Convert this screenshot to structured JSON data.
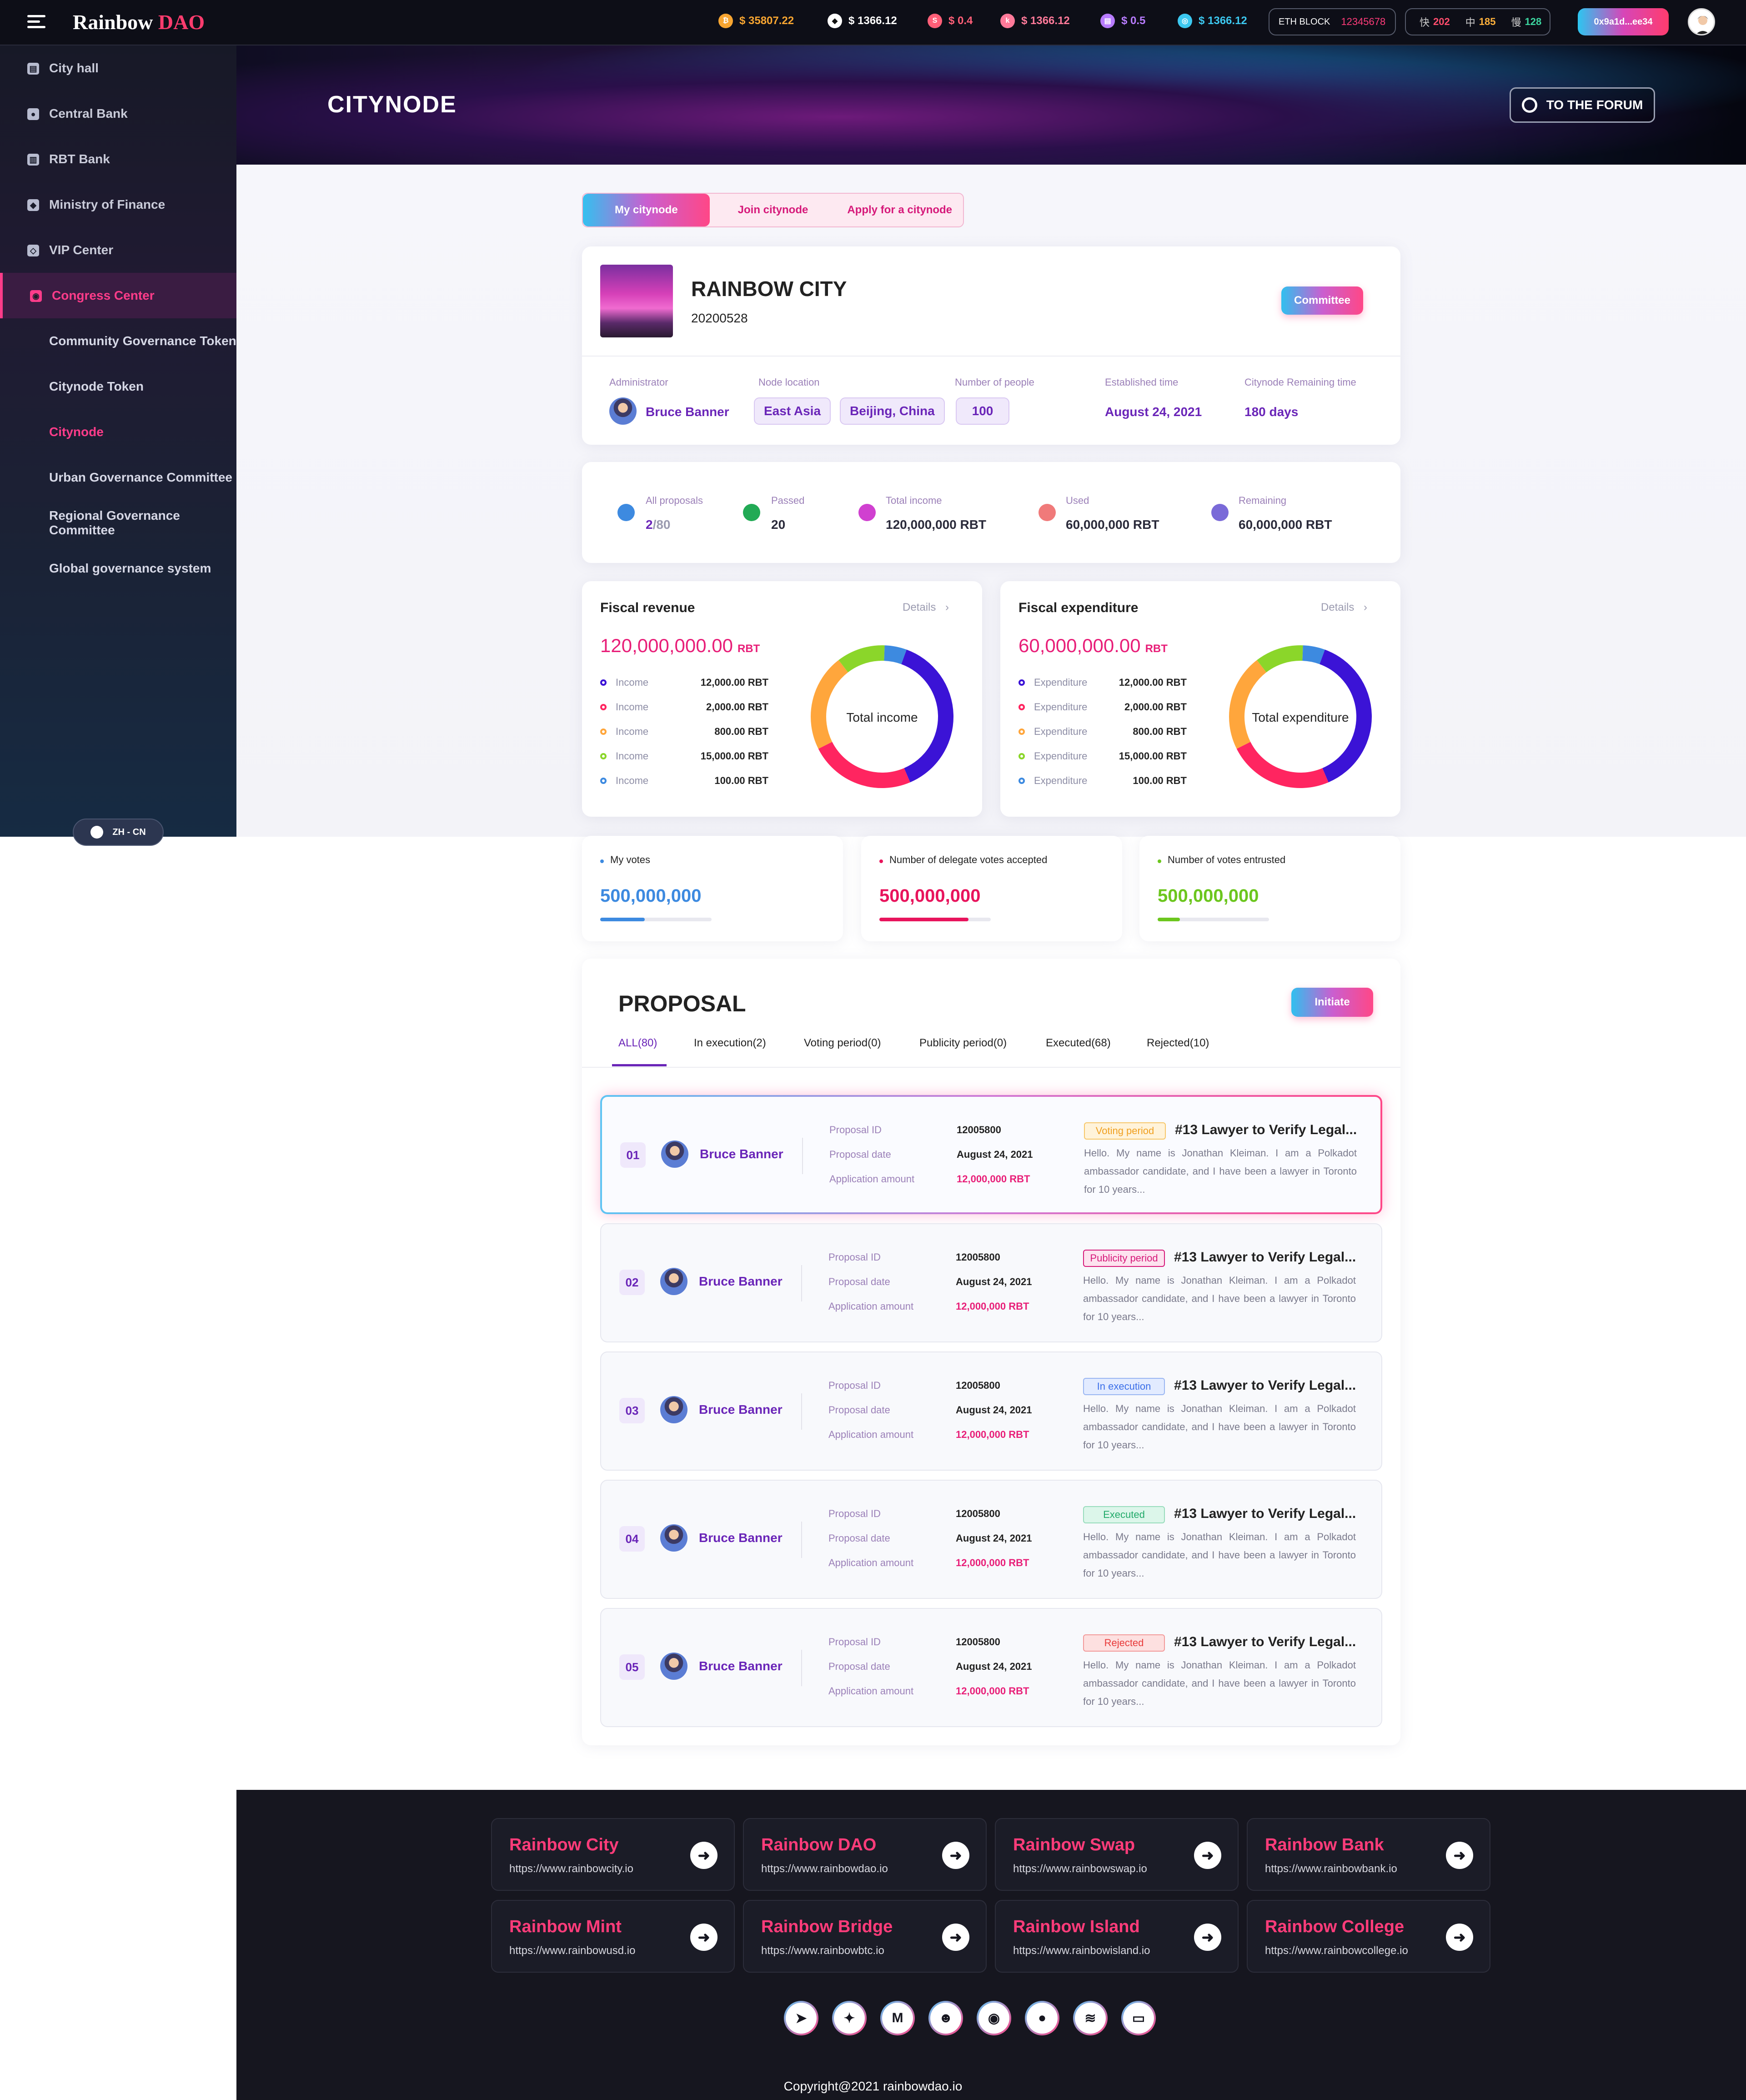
{
  "topbar": {
    "logo_main": "Rainbow",
    "logo_accent": "DAO",
    "prices": [
      {
        "icon": "bitcoin-icon",
        "symbol": "₿",
        "value": "$ 35807.22",
        "color": "#f7a531"
      },
      {
        "icon": "eth-icon",
        "symbol": "◆",
        "value": "$ 1366.12",
        "color": "#ffffff"
      },
      {
        "icon": "token-s-icon",
        "symbol": "S",
        "value": "$ 0.4",
        "color": "#ff5f78"
      },
      {
        "icon": "token-k-icon",
        "symbol": "k",
        "value": "$ 1366.12",
        "color": "#ff7a9a"
      },
      {
        "icon": "token-c-icon",
        "symbol": "▤",
        "value": "$ 0.5",
        "color": "#b87cff"
      },
      {
        "icon": "token-d-icon",
        "symbol": "◎",
        "value": "$ 1366.12",
        "color": "#3cc8f0"
      }
    ],
    "eth_block_label": "ETH BLOCK",
    "eth_block_value": "12345678",
    "speeds": [
      {
        "label": "快",
        "value": "202",
        "color": "#ff4d6d"
      },
      {
        "label": "中",
        "value": "185",
        "color": "#ffb13c"
      },
      {
        "label": "慢",
        "value": "128",
        "color": "#3cd6a0"
      }
    ],
    "wallet": "0x9a1d...ee34"
  },
  "sidebar": {
    "items": [
      {
        "label": "City hall",
        "icon": "chart-icon"
      },
      {
        "label": "Central Bank",
        "icon": "coin-icon"
      },
      {
        "label": "RBT Bank",
        "icon": "bank-icon"
      },
      {
        "label": "Ministry of Finance",
        "icon": "cube-icon"
      },
      {
        "label": "VIP Center",
        "icon": "diamond-icon"
      },
      {
        "label": "Congress Center",
        "icon": "chat-icon"
      }
    ],
    "subitems": [
      "Community Governance Token",
      "Citynode Token",
      "Citynode",
      "Urban Governance Committee",
      "Regional Governance Committee",
      "Global governance system"
    ],
    "lang": "ZH - CN"
  },
  "hero": {
    "title": "CITYNODE",
    "forum_button": "TO THE FORUM"
  },
  "tabs": [
    "My citynode",
    "Join citynode",
    "Apply for a citynode"
  ],
  "city": {
    "name": "RAINBOW CITY",
    "code": "20200528",
    "committee_button": "Committee",
    "admin_label": "Administrator",
    "admin_name": "Bruce Banner",
    "location_label": "Node location",
    "location_region": "East Asia",
    "location_city": "Beijing, China",
    "people_label": "Number of people",
    "people_value": "100",
    "established_label": "Established time",
    "established_value": "August 24, 2021",
    "remaining_label": "Citynode Remaining time",
    "remaining_value": "180 days"
  },
  "stats": {
    "proposals_label": "All proposals",
    "proposals_value": "2",
    "proposals_total": "/80",
    "passed_label": "Passed",
    "passed_value": "20",
    "income_label": "Total income",
    "income_value": "120,000,000 RBT",
    "used_label": "Used",
    "used_value": "60,000,000 RBT",
    "remaining_label": "Remaining",
    "remaining_value": "60,000,000 RBT"
  },
  "revenue": {
    "title": "Fiscal revenue",
    "details": "Details",
    "amount": "120,000,000.00",
    "unit": "RBT",
    "center": "Total income",
    "rows": [
      {
        "label": "Income",
        "value": "12,000.00 RBT",
        "color": "#3b13d6"
      },
      {
        "label": "Income",
        "value": "2,000.00 RBT",
        "color": "#ff2560"
      },
      {
        "label": "Income",
        "value": "800.00 RBT",
        "color": "#ffa63c"
      },
      {
        "label": "Income",
        "value": "15,000.00 RBT",
        "color": "#8bd62a"
      },
      {
        "label": "Income",
        "value": "100.00 RBT",
        "color": "#3d8ae0"
      }
    ],
    "donut": [
      {
        "value": 38,
        "color": "#3b13d6"
      },
      {
        "value": 24,
        "color": "#ff2560"
      },
      {
        "value": 22,
        "color": "#ffa63c"
      },
      {
        "value": 11,
        "color": "#8bd62a"
      },
      {
        "value": 5,
        "color": "#3d8ae0"
      }
    ]
  },
  "expenditure": {
    "title": "Fiscal expenditure",
    "details": "Details",
    "amount": "60,000,000.00",
    "unit": "RBT",
    "center": "Total expenditure",
    "rows": [
      {
        "label": "Expenditure",
        "value": "12,000.00 RBT",
        "color": "#3b13d6"
      },
      {
        "label": "Expenditure",
        "value": "2,000.00 RBT",
        "color": "#ff2560"
      },
      {
        "label": "Expenditure",
        "value": "800.00 RBT",
        "color": "#ffa63c"
      },
      {
        "label": "Expenditure",
        "value": "15,000.00 RBT",
        "color": "#8bd62a"
      },
      {
        "label": "Expenditure",
        "value": "100.00 RBT",
        "color": "#3d8ae0"
      }
    ],
    "donut": [
      {
        "value": 38,
        "color": "#3b13d6"
      },
      {
        "value": 24,
        "color": "#ff2560"
      },
      {
        "value": 22,
        "color": "#ffa63c"
      },
      {
        "value": 11,
        "color": "#8bd62a"
      },
      {
        "value": 5,
        "color": "#3d8ae0"
      }
    ]
  },
  "votes": [
    {
      "label": "My votes",
      "value": "500,000,000",
      "color": "#3d8ae0",
      "progress": 0.4
    },
    {
      "label": "Number of delegate votes accepted",
      "value": "500,000,000",
      "color": "#e8145c",
      "progress": 0.8
    },
    {
      "label": "Number of votes entrusted",
      "value": "500,000,000",
      "color": "#6cc61e",
      "progress": 0.2
    }
  ],
  "proposal": {
    "title": "PROPOSAL",
    "initiate": "Initiate",
    "tabs": [
      "ALL(80)",
      "In execution(2)",
      "Voting period(0)",
      "Publicity period(0)",
      "Executed(68)",
      "Rejected(10)"
    ],
    "id_label": "Proposal ID",
    "date_label": "Proposal date",
    "amount_label": "Application amount",
    "rows": [
      {
        "num": "01",
        "name": "Bruce Banner",
        "id": "12005800",
        "date": "August 24, 2021",
        "amount": "12,000,000 RBT",
        "status": "Voting period",
        "status_bg": "#fff3da",
        "status_color": "#f0a020",
        "status_border": "#f7c76a",
        "title": "#13 Lawyer to Verify Legal...",
        "desc": "Hello. My name is Jonathan Kleiman. I am a Polkadot ambassador candidate, and I have been a lawyer in Toronto for 10 years..."
      },
      {
        "num": "02",
        "name": "Bruce Banner",
        "id": "12005800",
        "date": "August 24, 2021",
        "amount": "12,000,000 RBT",
        "status": "Publicity period",
        "status_bg": "#fde3ef",
        "status_color": "#d6197a",
        "status_border": "#d6197a",
        "title": "#13 Lawyer to Verify Legal...",
        "desc": "Hello. My name is Jonathan Kleiman. I am a Polkadot ambassador candidate, and I have been a lawyer in Toronto for 10 years..."
      },
      {
        "num": "03",
        "name": "Bruce Banner",
        "id": "12005800",
        "date": "August 24, 2021",
        "amount": "12,000,000 RBT",
        "status": "In execution",
        "status_bg": "#e2ebff",
        "status_color": "#3a6ee8",
        "status_border": "#9ab6f2",
        "title": "#13 Lawyer to Verify Legal...",
        "desc": "Hello. My name is Jonathan Kleiman. I am a Polkadot ambassador candidate, and I have been a lawyer in Toronto for 10 years..."
      },
      {
        "num": "04",
        "name": "Bruce Banner",
        "id": "12005800",
        "date": "August 24, 2021",
        "amount": "12,000,000 RBT",
        "status": "Executed",
        "status_bg": "#dcf6ea",
        "status_color": "#22aa6a",
        "status_border": "#98dcbc",
        "title": "#13 Lawyer to Verify Legal...",
        "desc": "Hello. My name is Jonathan Kleiman. I am a Polkadot ambassador candidate, and I have been a lawyer in Toronto for 10 years..."
      },
      {
        "num": "05",
        "name": "Bruce Banner",
        "id": "12005800",
        "date": "August 24, 2021",
        "amount": "12,000,000 RBT",
        "status": "Rejected",
        "status_bg": "#fde0e0",
        "status_color": "#e83a3a",
        "status_border": "#f29a9a",
        "title": "#13 Lawyer to Verify Legal...",
        "desc": "Hello. My name is Jonathan Kleiman. I am a Polkadot ambassador candidate, and I have been a lawyer in Toronto for 10 years..."
      }
    ]
  },
  "footer": {
    "links": [
      {
        "title": "Rainbow City",
        "url": "https://www.rainbowcity.io"
      },
      {
        "title": "Rainbow DAO",
        "url": "https://www.rainbowdao.io"
      },
      {
        "title": "Rainbow Swap",
        "url": "https://www.rainbowswap.io"
      },
      {
        "title": "Rainbow Bank",
        "url": "https://www.rainbowbank.io"
      },
      {
        "title": "Rainbow Mint",
        "url": "https://www.rainbowusd.io"
      },
      {
        "title": "Rainbow Bridge",
        "url": "https://www.rainbowbtc.io"
      },
      {
        "title": "Rainbow Island",
        "url": "https://www.rainbowisland.io"
      },
      {
        "title": "Rainbow College",
        "url": "https://www.rainbowcollege.io"
      }
    ],
    "socials": [
      {
        "name": "telegram-icon",
        "glyph": "➤"
      },
      {
        "name": "twitter-icon",
        "glyph": "✦"
      },
      {
        "name": "medium-icon",
        "glyph": "M"
      },
      {
        "name": "reddit-icon",
        "glyph": "☻"
      },
      {
        "name": "discord-icon",
        "glyph": "◉"
      },
      {
        "name": "github-icon",
        "glyph": "●"
      },
      {
        "name": "gitbook-icon",
        "glyph": "≋"
      },
      {
        "name": "forum-icon",
        "glyph": "▭"
      }
    ],
    "copyright": "Copyright@2021 rainbowdao.io"
  }
}
